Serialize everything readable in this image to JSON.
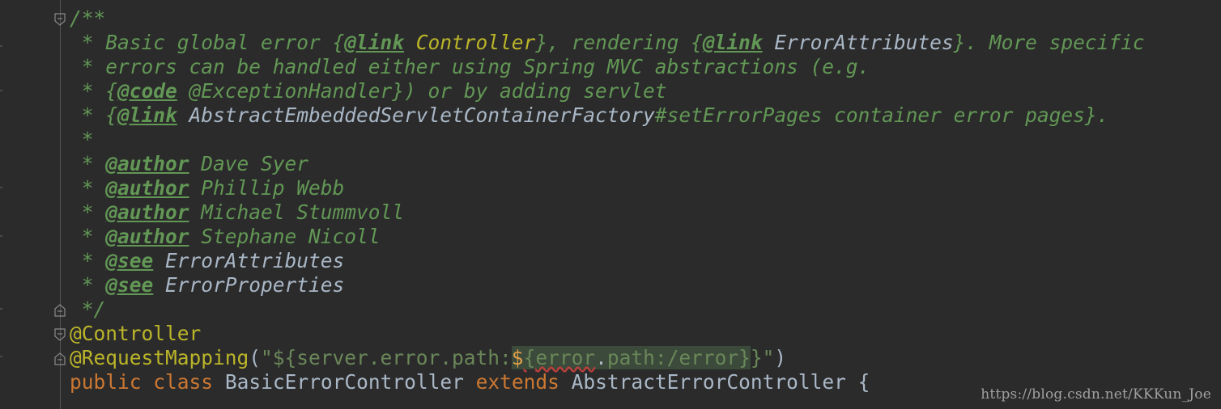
{
  "editor": {
    "theme_colors": {
      "background": "#2b2b2b",
      "doc_comment": "#629755",
      "annotation": "#bbb529",
      "keyword": "#cc7832",
      "string": "#6a8759",
      "identifier": "#a9b7c6"
    },
    "lines": {
      "l1": {
        "open": "/**"
      },
      "l2": {
        "star": " * ",
        "t1": "Basic global error {",
        "tag1": "@link",
        "ref1": " Controller",
        "t2": "}, rendering {",
        "tag2": "@link",
        "ref2": " ErrorAttributes",
        "t3": "}. More specific"
      },
      "l3": {
        "star": " * ",
        "text": "errors can be handled either using Spring MVC abstractions (e.g."
      },
      "l4": {
        "star": " * ",
        "t1": "{",
        "tag": "@code",
        "t2": " @ExceptionHandler}) or by adding servlet"
      },
      "l5": {
        "star": " * ",
        "t1": "{",
        "tag": "@link",
        "ref": " AbstractEmbeddedServletContainerFactory",
        "t2": "#setErrorPages container error pages}."
      },
      "l6": {
        "star": " *"
      },
      "l7": {
        "star": " * ",
        "tag": "@author",
        "text": " Dave Syer"
      },
      "l8": {
        "star": " * ",
        "tag": "@author",
        "text": " Phillip Webb"
      },
      "l9": {
        "star": " * ",
        "tag": "@author",
        "text": " Michael Stummvoll"
      },
      "l10": {
        "star": " * ",
        "tag": "@author",
        "text": " Stephane Nicoll"
      },
      "l11": {
        "star": " * ",
        "tag": "@see",
        "text": " ErrorAttributes"
      },
      "l12": {
        "star": " * ",
        "tag": "@see",
        "text": " ErrorProperties"
      },
      "l13": {
        "close": " */"
      },
      "l14": {
        "annotation": "@Controller"
      },
      "l15": {
        "annotation": "@RequestMapping",
        "paren_open": "(",
        "str1": "\"${server.error.path:",
        "dollar": "$",
        "brace": "{",
        "inj_ident": "error",
        "inj_dot": ".",
        "inj_rest": "path:/error}",
        "str2": "}\"",
        "paren_close": ")"
      },
      "l16": {
        "kw1": "public",
        "kw2": "class",
        "cls": "BasicErrorController",
        "kw3": "extends",
        "parent": "AbstractErrorController",
        "brace": "{"
      }
    }
  },
  "watermark": {
    "text": "https://blog.csdn.net/KKKun_Joe"
  },
  "icons": {
    "fold_open": "fold-collapse-icon",
    "fold_close": "fold-end-icon"
  }
}
